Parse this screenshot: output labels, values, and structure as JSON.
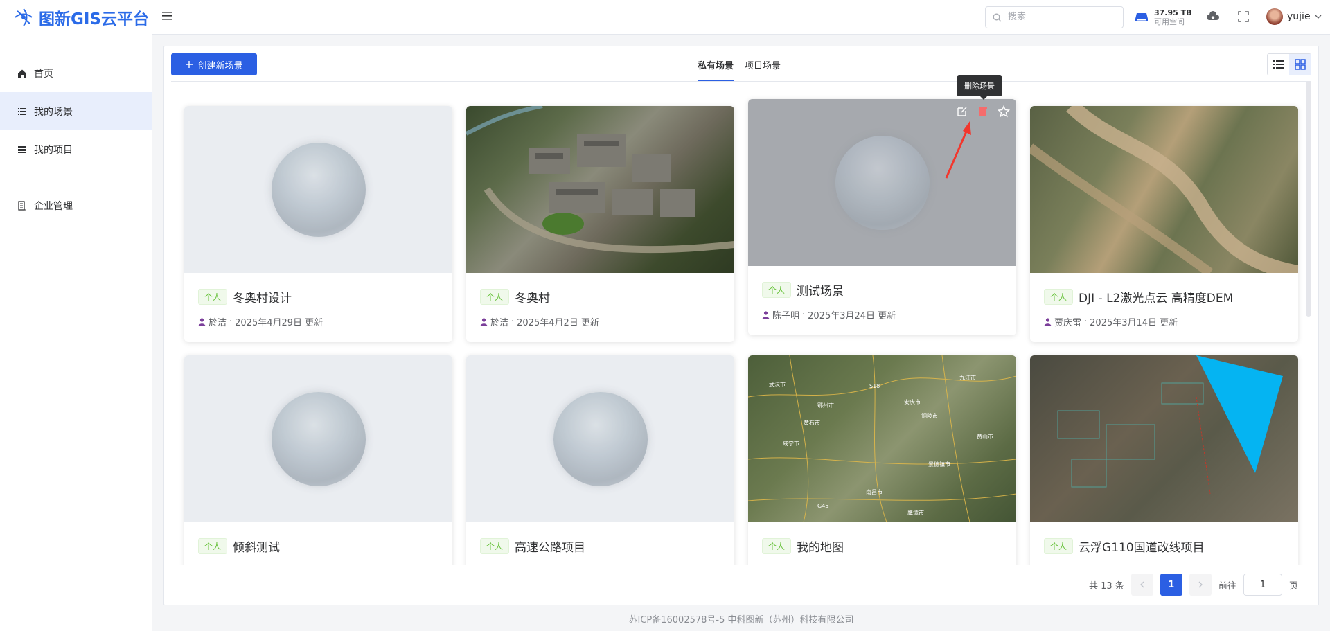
{
  "app": {
    "title": "图新GIS云平台"
  },
  "sidebar": {
    "items": [
      {
        "label": "首页",
        "icon": "home-icon"
      },
      {
        "label": "我的场景",
        "icon": "list-icon"
      },
      {
        "label": "我的项目",
        "icon": "project-icon"
      },
      {
        "label": "企业管理",
        "icon": "building-icon"
      }
    ]
  },
  "header": {
    "search_placeholder": "搜索",
    "storage_value": "37.95 TB",
    "storage_label": "可用空间",
    "username": "yujie"
  },
  "toolbar": {
    "create_label": "创建新场景"
  },
  "tabs": [
    {
      "label": "私有场景"
    },
    {
      "label": "项目场景"
    }
  ],
  "tooltip": "删除场景",
  "cards": [
    {
      "tag": "个人",
      "title": "冬奥村设计",
      "author": "於洁",
      "date": "2025年4月29日 更新",
      "thumb": "blank"
    },
    {
      "tag": "个人",
      "title": "冬奥村",
      "author": "於洁",
      "date": "2025年4月2日 更新",
      "thumb": "aerial-village"
    },
    {
      "tag": "个人",
      "title": "测试场景",
      "author": "陈子明",
      "date": "2025年3月24日 更新",
      "thumb": "blank-hover"
    },
    {
      "tag": "个人",
      "title": "DJI - L2激光点云 高精度DEM",
      "author": "贾庆雷",
      "date": "2025年3月14日 更新",
      "thumb": "terrain"
    },
    {
      "tag": "个人",
      "title": "倾斜测试",
      "author": "",
      "date": "",
      "thumb": "blank"
    },
    {
      "tag": "个人",
      "title": "高速公路项目",
      "author": "",
      "date": "",
      "thumb": "blank"
    },
    {
      "tag": "个人",
      "title": "我的地图",
      "author": "",
      "date": "",
      "thumb": "map"
    },
    {
      "tag": "个人",
      "title": "云浮G110国道改线项目",
      "author": "",
      "date": "",
      "thumb": "site"
    }
  ],
  "map_labels": [
    "武汉市",
    "九江市",
    "南昌市",
    "黄石市",
    "咸宁市",
    "安庆市",
    "黄山市",
    "景德镇市",
    "鹰潭市",
    "铜陵市",
    "鄂州市",
    "S18",
    "G45"
  ],
  "pagination": {
    "total": "共 13 条",
    "current": "1",
    "goto_label": "前往",
    "goto_value": "1",
    "page_unit": "页"
  },
  "footer": "苏ICP备16002578号-5 中科图新（苏州）科技有限公司"
}
